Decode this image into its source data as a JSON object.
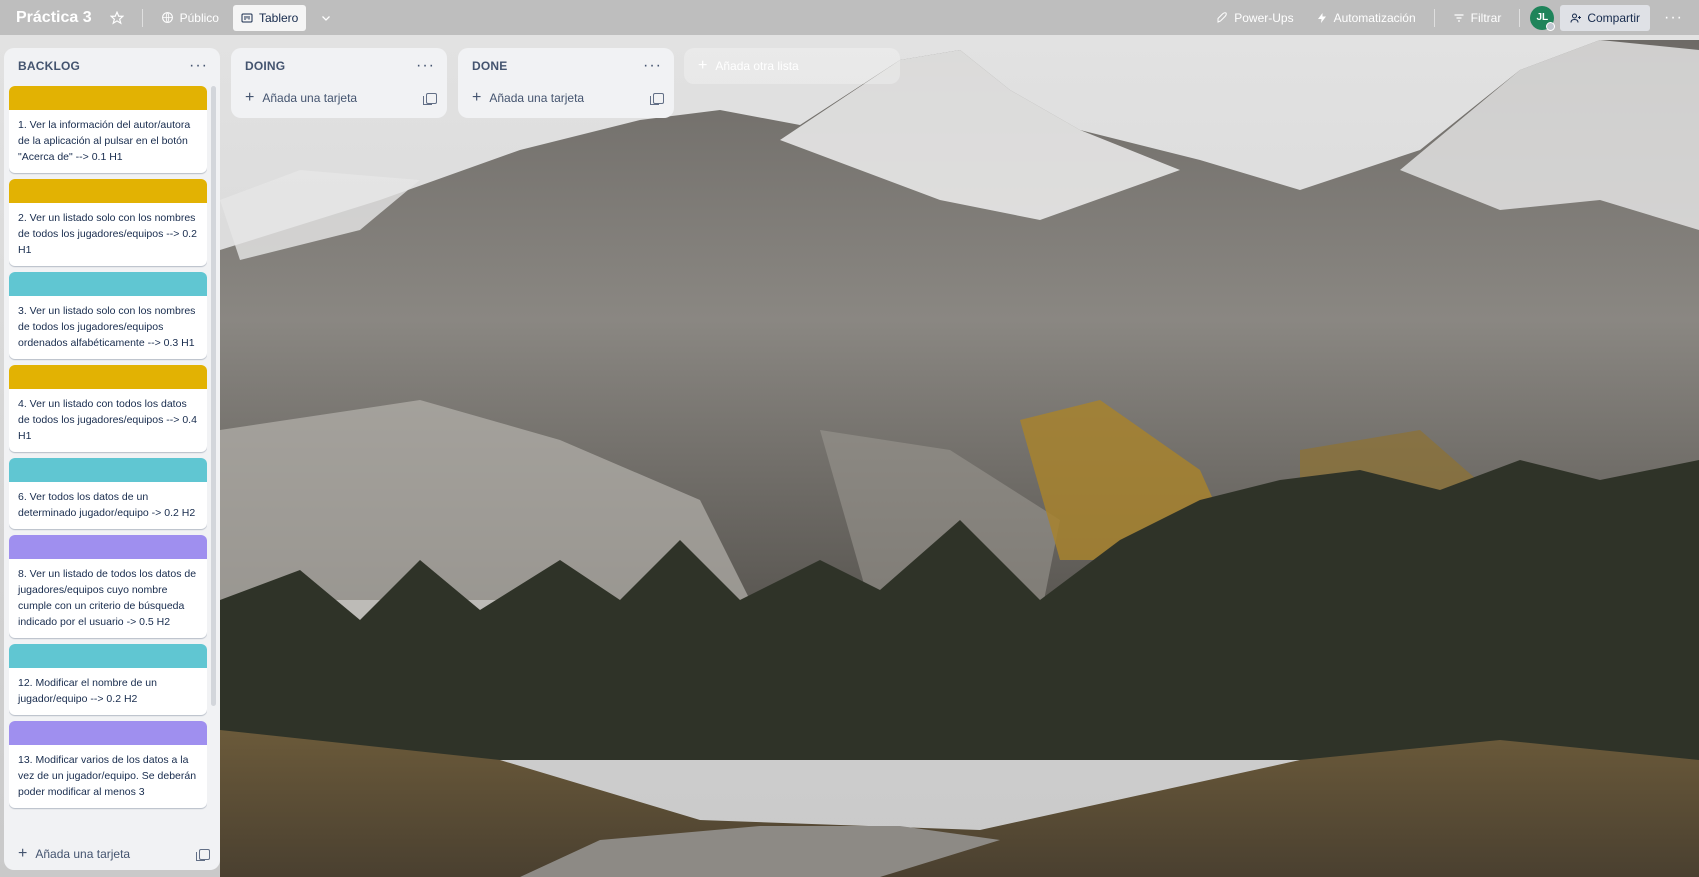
{
  "topbar": {
    "board_title": "Práctica 3",
    "visibility_label": "Público",
    "view_label": "Tablero",
    "powerups_label": "Power-Ups",
    "automation_label": "Automatización",
    "filter_label": "Filtrar",
    "avatar_initials": "JL",
    "share_label": "Compartir"
  },
  "lists": [
    {
      "title": "BACKLOG",
      "add_card_label": "Añada una tarjeta",
      "cards": [
        {
          "cover_color": "#e2b203",
          "text": "1. Ver la información del autor/autora de la aplicación al pulsar en el botón \"Acerca de\" --> 0.1 H1"
        },
        {
          "cover_color": "#e2b203",
          "text": "2. Ver un listado solo con los nombres de todos los jugadores/equipos --> 0.2 H1"
        },
        {
          "cover_color": "#60c6d2",
          "text": "3. Ver un listado solo con los nombres de todos los jugadores/equipos ordenados alfabéticamente --> 0.3 H1"
        },
        {
          "cover_color": "#e2b203",
          "text": "4. Ver un listado con todos los datos de todos los jugadores/equipos --> 0.4 H1"
        },
        {
          "cover_color": "#60c6d2",
          "text": "6. Ver todos los datos de un determinado jugador/equipo -> 0.2 H2"
        },
        {
          "cover_color": "#9f8fef",
          "text": "8. Ver un listado de todos los datos de jugadores/equipos cuyo nombre cumple con un criterio de búsqueda indicado por el usuario -> 0.5 H2"
        },
        {
          "cover_color": "#60c6d2",
          "text": "12. Modificar el nombre de un jugador/equipo --> 0.2 H2"
        },
        {
          "cover_color": "#9f8fef",
          "text": "13. Modificar varios de los datos a la vez de un jugador/equipo. Se deberán poder modificar al menos 3"
        }
      ]
    },
    {
      "title": "DOING",
      "add_card_label": "Añada una tarjeta",
      "cards": []
    },
    {
      "title": "DONE",
      "add_card_label": "Añada una tarjeta",
      "cards": []
    }
  ],
  "add_list_label": "Añada otra lista",
  "icons": {
    "star": "star-icon",
    "visibility": "globe-icon",
    "view": "board-icon",
    "view_switch": "chevron-down-icon",
    "powerups": "rocket-icon",
    "automation": "lightning-icon",
    "filter": "filter-icon",
    "share": "person-add-icon",
    "more": "ellipsis-icon"
  }
}
